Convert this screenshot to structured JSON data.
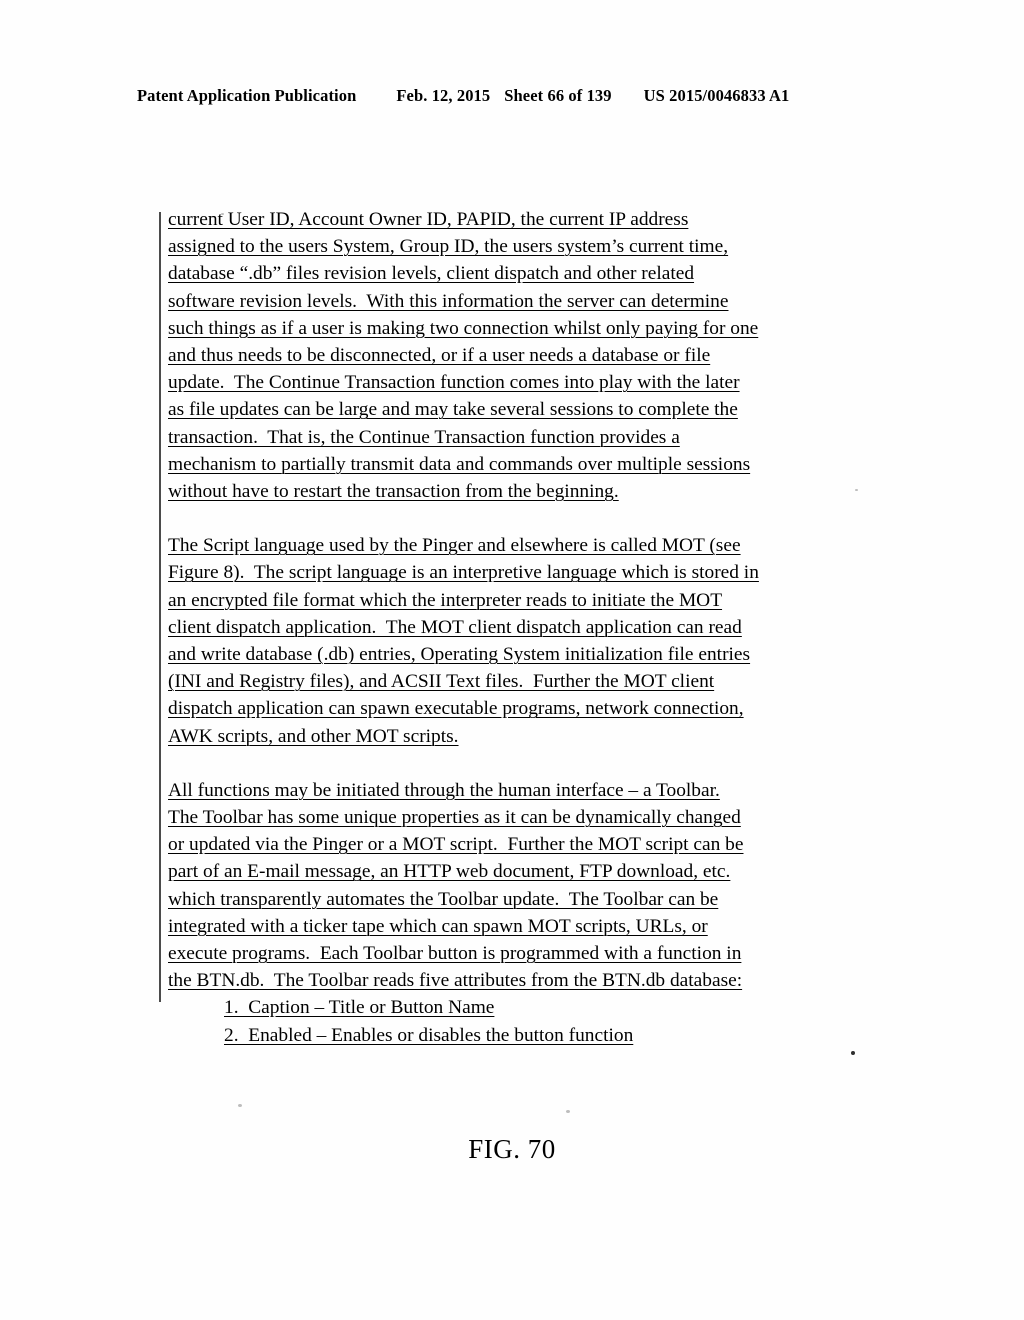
{
  "header": {
    "publication": "Patent Application Publication",
    "date": "Feb. 12, 2015",
    "sheet": "Sheet 66 of 139",
    "doc_number": "US 2015/0046833 A1"
  },
  "figure": {
    "caption": "FIG. 70"
  },
  "body": {
    "paragraphs": [
      {
        "id": "paragraph-1",
        "lines": [
          "current User ID, Account Owner ID, PAPID, the current IP address",
          "assigned to the users System, Group ID, the users system’s current time,",
          "database “.db” files revision levels, client dispatch and other related",
          "software revision levels.  With this information the server can determine",
          "such things as if a user is making two connection whilst only paying for one",
          "and thus needs to be disconnected, or if a user needs a database or file",
          "update.  The Continue Transaction function comes into play with the later",
          "as file updates can be large and may take several sessions to complete the",
          "transaction.  That is, the Continue Transaction function provides a",
          "mechanism to partially transmit data and commands over multiple sessions",
          "without have to restart the transaction from the beginning."
        ]
      },
      {
        "id": "paragraph-2",
        "lines": [
          "The Script language used by the Pinger and elsewhere is called MOT (see",
          "Figure 8).  The script language is an interpretive language which is stored in",
          "an encrypted file format which the interpreter reads to initiate the MOT",
          "client dispatch application.  The MOT client dispatch application can read",
          "and write database (.db) entries, Operating System initialization file entries",
          "(INI and Registry files), and ACSII Text files.  Further the MOT client",
          "dispatch application can spawn executable programs, network connection,",
          "AWK scripts, and other MOT scripts."
        ]
      },
      {
        "id": "paragraph-3",
        "lines": [
          "All functions may be initiated through the human interface – a Toolbar.",
          "The Toolbar has some unique properties as it can be dynamically changed",
          "or updated via the Pinger or a MOT script.  Further the MOT script can be",
          "part of an E-mail message, an HTTP web document, FTP download, etc.",
          "which transparently automates the Toolbar update.  The Toolbar can be",
          "integrated with a ticker tape which can spawn MOT scripts, URLs, or",
          "execute programs.  Each Toolbar button is programmed with a function in",
          "the BTN.db.  The Toolbar reads five attributes from the BTN.db database:"
        ]
      }
    ],
    "attribute_list": [
      "1.  Caption – Title or Button Name",
      "2.  Enabled – Enables or disables the button function"
    ]
  },
  "style": {
    "text_color": "#000000",
    "page_background": "#fefefe",
    "change_bar_color": "#2b2b2b"
  }
}
